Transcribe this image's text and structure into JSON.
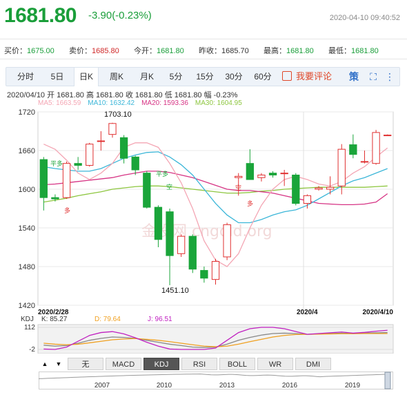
{
  "quote": {
    "price": "1681.80",
    "change": "-3.90(-0.23%)",
    "datetime": "2020-04-10 09:40:52"
  },
  "info": [
    {
      "label": "买价：",
      "value": "1675.00",
      "color": "green"
    },
    {
      "label": "卖价：",
      "value": "1685.80",
      "color": "red"
    },
    {
      "label": "今开：",
      "value": "1681.80",
      "color": "green"
    },
    {
      "label": "昨收：",
      "value": "1685.70",
      "color": "plain"
    },
    {
      "label": "最高：",
      "value": "1681.80",
      "color": "green"
    },
    {
      "label": "最低：",
      "value": "1681.80",
      "color": "green"
    }
  ],
  "tabs": [
    "分时",
    "5日",
    "日K",
    "周K",
    "月K",
    "5分",
    "15分",
    "30分",
    "60分"
  ],
  "active_tab": "日K",
  "review_label": "我要评论",
  "toolbar_icons": [
    "strategy-icon",
    "fullscreen-icon",
    "more-icon"
  ],
  "toolbar_glyphs": {
    "strategy": "策",
    "fullscreen": "⛶",
    "more": "⋮"
  },
  "ohlc_line": "2020/04/10  开 1681.80  高 1681.80  收 1681.80  低 1681.80  幅 -0.23%",
  "ma_legend": [
    {
      "label": "MA5: 1663.59",
      "color": "#f4a6b4"
    },
    {
      "label": "MA10: 1632.42",
      "color": "#3bb6d8"
    },
    {
      "label": "MA20: 1593.36",
      "color": "#d63384"
    },
    {
      "label": "MA30: 1604.95",
      "color": "#8dc63f"
    }
  ],
  "kdj_legend": {
    "title": "KDJ",
    "k": "K: 85.27",
    "d": "D: 79.64",
    "j": "J: 96.51",
    "k_color": "#888888",
    "d_color": "#f0a020",
    "j_color": "#c020c0"
  },
  "kdj_ticks": [
    "112",
    "-2"
  ],
  "bottom_tabs": [
    "无",
    "MACD",
    "KDJ",
    "RSI",
    "BOLL",
    "WR",
    "DMI"
  ],
  "active_bottom_tab": "KDJ",
  "nav_arrows": [
    "▲",
    "▼"
  ],
  "overview_years": [
    "2007",
    "2010",
    "2013",
    "2016",
    "2019"
  ],
  "annotations": {
    "high_label": "1703.10",
    "low_label": "1451.10",
    "signals": [
      "平多",
      "多",
      "平多",
      "空",
      "空",
      "平空",
      "多"
    ]
  },
  "watermark": "金投网 cngold.org",
  "chart_data": {
    "type": "candlestick",
    "ylim": [
      1420,
      1730
    ],
    "yticks": [
      1720,
      1660,
      1600,
      1540,
      1480,
      1420
    ],
    "x_labels": [
      "2020/2/28",
      "2020/4",
      "2020/4/10"
    ],
    "up_color": "#e03030",
    "down_color": "#1aa53a",
    "candles": [
      {
        "o": 1646,
        "h": 1650,
        "l": 1567,
        "c": 1587
      },
      {
        "o": 1587,
        "h": 1592,
        "l": 1581,
        "c": 1585
      },
      {
        "o": 1587,
        "h": 1643,
        "l": 1585,
        "c": 1640
      },
      {
        "o": 1640,
        "h": 1650,
        "l": 1630,
        "c": 1637
      },
      {
        "o": 1637,
        "h": 1672,
        "l": 1635,
        "c": 1670
      },
      {
        "o": 1675,
        "h": 1690,
        "l": 1660,
        "c": 1675
      },
      {
        "o": 1685,
        "h": 1703.1,
        "l": 1680,
        "c": 1702
      },
      {
        "o": 1680,
        "h": 1684,
        "l": 1640,
        "c": 1648
      },
      {
        "o": 1650,
        "h": 1652,
        "l": 1622,
        "c": 1630
      },
      {
        "o": 1625,
        "h": 1628,
        "l": 1570,
        "c": 1572
      },
      {
        "o": 1572,
        "h": 1575,
        "l": 1510,
        "c": 1522
      },
      {
        "o": 1565,
        "h": 1570,
        "l": 1451.1,
        "c": 1497
      },
      {
        "o": 1500,
        "h": 1530,
        "l": 1495,
        "c": 1527
      },
      {
        "o": 1527,
        "h": 1530,
        "l": 1470,
        "c": 1476
      },
      {
        "o": 1474,
        "h": 1480,
        "l": 1455,
        "c": 1462
      },
      {
        "o": 1460,
        "h": 1492,
        "l": 1452,
        "c": 1488
      },
      {
        "o": 1495,
        "h": 1548,
        "l": 1490,
        "c": 1545
      },
      {
        "o": 1618,
        "h": 1625,
        "l": 1590,
        "c": 1620
      },
      {
        "o": 1640,
        "h": 1662,
        "l": 1618,
        "c": 1615
      },
      {
        "o": 1618,
        "h": 1625,
        "l": 1612,
        "c": 1622
      },
      {
        "o": 1625,
        "h": 1628,
        "l": 1618,
        "c": 1622
      },
      {
        "o": 1625,
        "h": 1630,
        "l": 1605,
        "c": 1625
      },
      {
        "o": 1622,
        "h": 1625,
        "l": 1575,
        "c": 1578
      },
      {
        "o": 1578,
        "h": 1592,
        "l": 1570,
        "c": 1590
      },
      {
        "o": 1600,
        "h": 1605,
        "l": 1598,
        "c": 1602
      },
      {
        "o": 1600,
        "h": 1620,
        "l": 1592,
        "c": 1603
      },
      {
        "o": 1605,
        "h": 1670,
        "l": 1592,
        "c": 1662
      },
      {
        "o": 1669,
        "h": 1685,
        "l": 1648,
        "c": 1654
      },
      {
        "o": 1643,
        "h": 1660,
        "l": 1640,
        "c": 1643
      },
      {
        "o": 1640,
        "h": 1692,
        "l": 1638,
        "c": 1688
      },
      {
        "o": 1684,
        "h": 1685,
        "l": 1684,
        "c": 1684
      }
    ],
    "ma5": [
      1670,
      1662,
      1645,
      1625,
      1615,
      1625,
      1640,
      1665,
      1672,
      1672,
      1665,
      1640,
      1610,
      1570,
      1520,
      1490,
      1480,
      1500,
      1540,
      1575,
      1600,
      1615,
      1620,
      1615,
      1608,
      1605,
      1612,
      1625,
      1635,
      1650,
      1664
    ],
    "ma10": [
      1635,
      1632,
      1630,
      1628,
      1628,
      1632,
      1640,
      1648,
      1653,
      1657,
      1658,
      1650,
      1638,
      1622,
      1600,
      1578,
      1560,
      1548,
      1548,
      1553,
      1560,
      1565,
      1568,
      1575,
      1585,
      1595,
      1605,
      1613,
      1618,
      1625,
      1632
    ],
    "ma20": [
      1607,
      1608,
      1610,
      1612,
      1614,
      1616,
      1618,
      1622,
      1625,
      1628,
      1628,
      1626,
      1622,
      1618,
      1612,
      1606,
      1600,
      1598,
      1598,
      1596,
      1594,
      1590,
      1586,
      1582,
      1578,
      1577,
      1576,
      1576,
      1577,
      1580,
      1593
    ],
    "ma30": [
      1580,
      1583,
      1586,
      1590,
      1593,
      1596,
      1600,
      1602,
      1604,
      1605,
      1605,
      1604,
      1602,
      1600,
      1598,
      1596,
      1594,
      1594,
      1595,
      1597,
      1598,
      1600,
      1601,
      1602,
      1603,
      1603,
      1603,
      1603,
      1603,
      1604,
      1605
    ],
    "kdj": {
      "ylim": [
        -2,
        112
      ],
      "k": [
        20,
        15,
        18,
        30,
        45,
        55,
        62,
        60,
        55,
        45,
        35,
        25,
        18,
        10,
        8,
        10,
        25,
        45,
        60,
        72,
        80,
        82,
        80,
        76,
        78,
        80,
        82,
        80,
        82,
        84,
        85
      ],
      "d": [
        30,
        25,
        22,
        25,
        32,
        40,
        48,
        52,
        54,
        50,
        45,
        38,
        30,
        22,
        15,
        12,
        15,
        25,
        38,
        50,
        62,
        70,
        75,
        76,
        77,
        78,
        79,
        79,
        80,
        80,
        80
      ],
      "j": [
        0,
        -2,
        10,
        40,
        70,
        85,
        90,
        78,
        58,
        35,
        15,
        0,
        -2,
        -2,
        -2,
        5,
        45,
        85,
        105,
        112,
        112,
        105,
        90,
        76,
        80,
        84,
        88,
        82,
        86,
        92,
        97
      ]
    }
  }
}
